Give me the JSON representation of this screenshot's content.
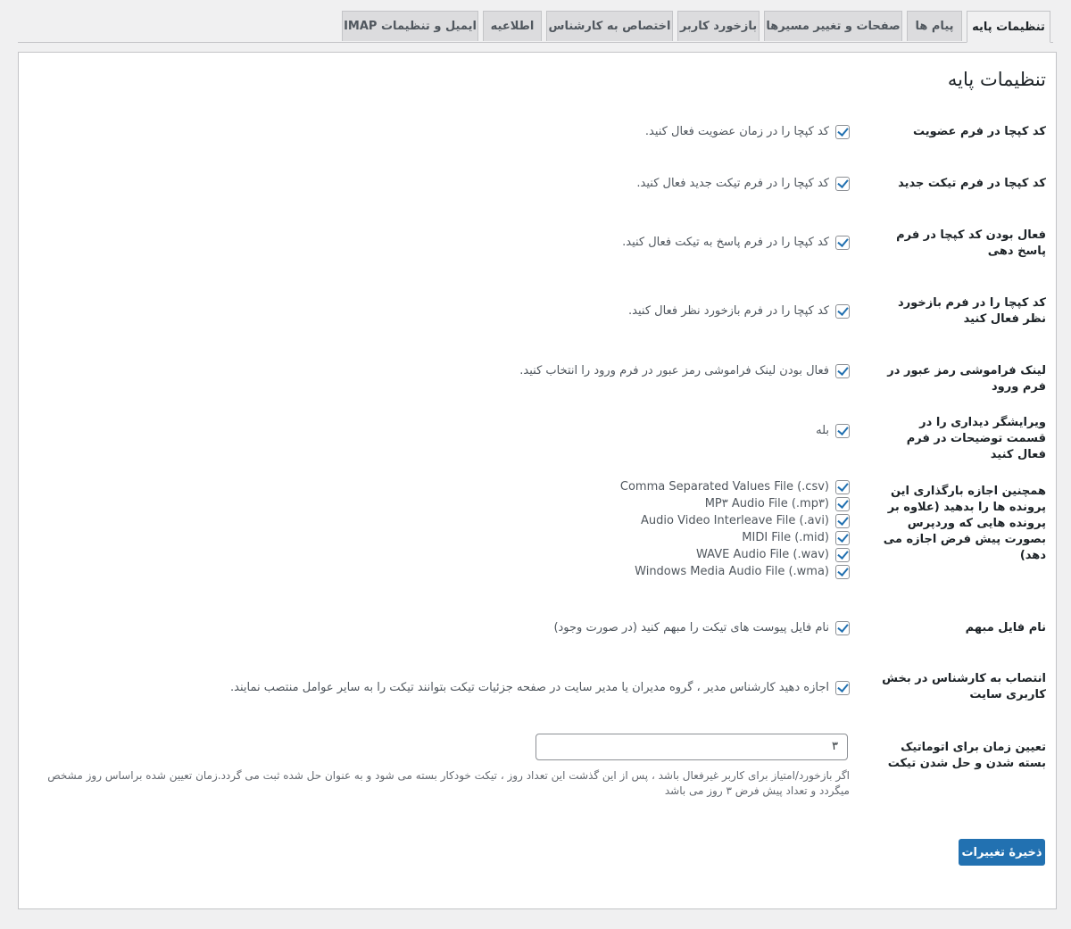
{
  "tabs": [
    {
      "label": "تنظیمات پایه"
    },
    {
      "label": "پیام ها"
    },
    {
      "label": "صفحات و تغییر مسیرها"
    },
    {
      "label": "بازخورد کاربر"
    },
    {
      "label": "اختصاص به کارشناس"
    },
    {
      "label": "اطلاعیه"
    },
    {
      "label": "ایمیل و تنظیمات IMAP"
    }
  ],
  "page_title": "تنظیمات پایه",
  "settings": {
    "captcha_register": {
      "label": "کد کپچا در فرم عضویت",
      "checked": true,
      "text": "کد کپچا را در زمان عضویت فعال کنید."
    },
    "captcha_new_ticket": {
      "label": "کد کپچا در فرم تیکت جدید",
      "checked": true,
      "text": "کد کپچا را در فرم تیکت جدید فعال کنید."
    },
    "captcha_reply": {
      "label": "فعال بودن کد کپچا در فرم پاسخ دهی",
      "checked": true,
      "text": "کد کپچا را در فرم پاسخ به تیکت فعال کنید."
    },
    "captcha_feedback": {
      "label": "کد کپچا را در فرم بازخورد نظر فعال کنید",
      "checked": true,
      "text": "کد کپچا را در فرم بازخورد نظر فعال کنید."
    },
    "forgot_password": {
      "label": "لینک فراموشی رمز عبور در فرم ورود",
      "checked": true,
      "text": "فعال بودن لینک فراموشی رمز عبور در فرم ورود را انتخاب کنید."
    },
    "visual_editor": {
      "label": "ویرایشگر دیداری را در قسمت توضیحات در فرم فعال کنید",
      "checked": true,
      "text": "بله"
    },
    "file_types": {
      "label": "همچنین اجازه بارگذاری این پرونده ها را بدهید (علاوه بر پرونده هایی که وردپرس بصورت پیش فرض اجازه می دهد)",
      "items": [
        {
          "text": "Comma Separated Values File (.csv)",
          "checked": true
        },
        {
          "text": "MP۳ Audio File (.mp۳)",
          "checked": true
        },
        {
          "text": "Audio Video Interleave File (.avi)",
          "checked": true
        },
        {
          "text": "MIDI File (.mid)",
          "checked": true
        },
        {
          "text": "WAVE Audio File (.wav)",
          "checked": true
        },
        {
          "text": "Windows Media Audio File (.wma)",
          "checked": true
        }
      ]
    },
    "obscure_filename": {
      "label": "نام فایل مبهم",
      "checked": true,
      "text": "نام فایل پیوست های تیکت را مبهم کنید (در صورت وجود)"
    },
    "assign_agent": {
      "label": "انتصاب به کارشناس در بخش کاربری سایت",
      "checked": true,
      "text": "اجازه دهید کارشناس مدیر ، گروه مدیران یا مدیر سایت در صفحه جزئیات تیکت بتوانند تیکت را به سایر عوامل منتصب نمایند."
    },
    "auto_close": {
      "label": "تعیین زمان برای اتوماتیک بسته شدن و حل شدن تیکت",
      "value": "۳",
      "description": "اگر بازخورد/امتیاز برای کاربر غیرفعال باشد ، پس از این گذشت این تعداد روز ، تیکت خودکار بسته می شود و به عنوان حل شده ثبت می گردد.زمان تعیین شده براساس روز مشخص میگردد و تعداد پیش فرض ۳ روز می باشد"
    }
  },
  "save_label": "ذخیرهٔ تغییرات",
  "colors": {
    "accent": "#2271b1",
    "background": "#f0f0f1",
    "panel": "#ffffff"
  }
}
